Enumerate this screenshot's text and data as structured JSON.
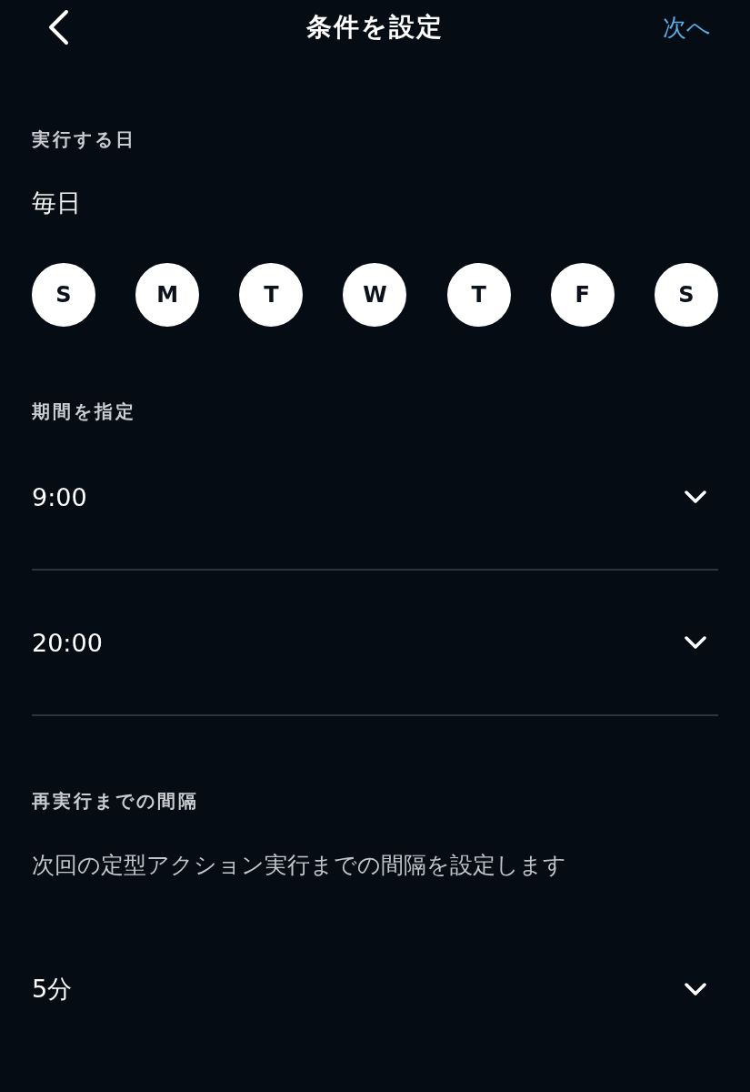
{
  "header": {
    "title": "条件を設定",
    "next": "次へ"
  },
  "days_section": {
    "label": "実行する日",
    "summary": "毎日",
    "days": [
      {
        "label": "S",
        "selected": true
      },
      {
        "label": "M",
        "selected": true
      },
      {
        "label": "T",
        "selected": true
      },
      {
        "label": "W",
        "selected": true
      },
      {
        "label": "T",
        "selected": true
      },
      {
        "label": "F",
        "selected": true
      },
      {
        "label": "S",
        "selected": true
      }
    ]
  },
  "period_section": {
    "label": "期間を指定",
    "dropdowns": [
      {
        "value": "9:00"
      },
      {
        "value": "20:00"
      }
    ]
  },
  "interval_section": {
    "label": "再実行までの間隔",
    "description": "次回の定型アクション実行までの間隔を設定します",
    "dropdown": {
      "value": "5分"
    }
  }
}
